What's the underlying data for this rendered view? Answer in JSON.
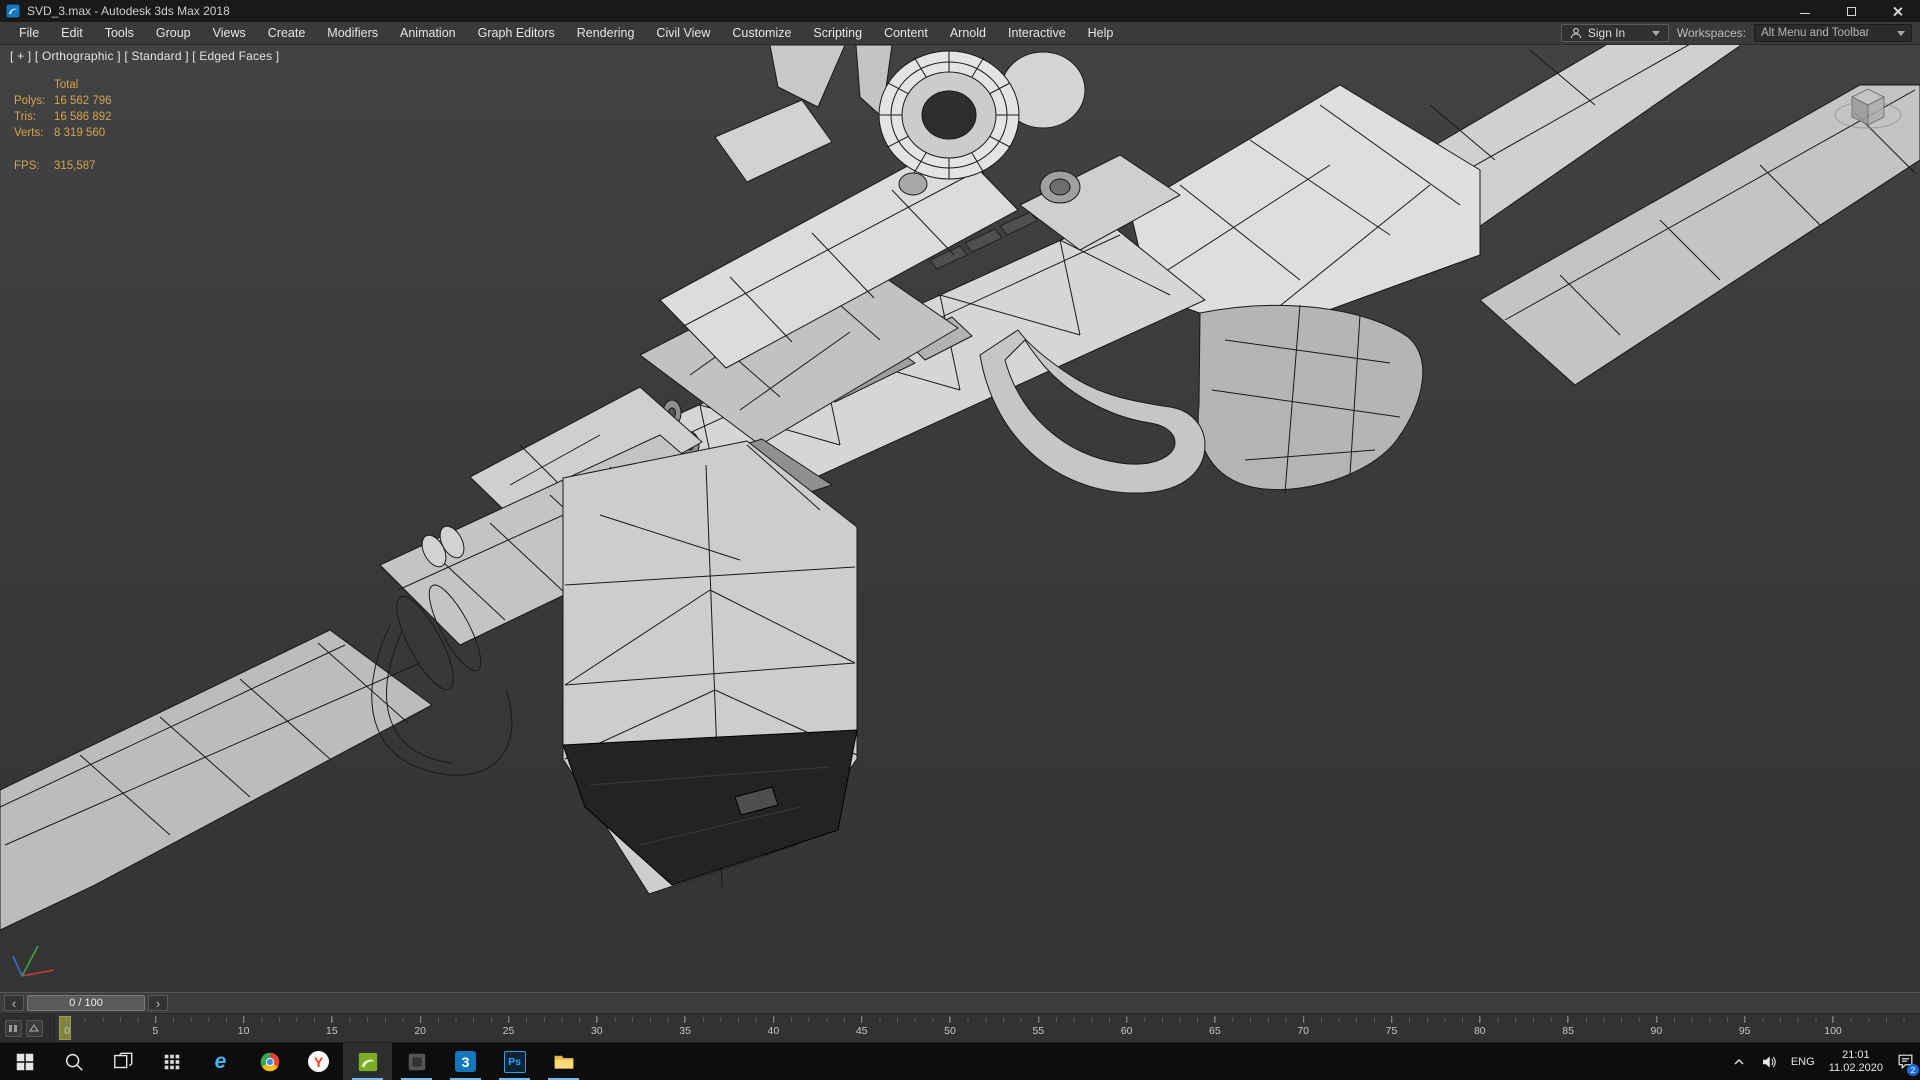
{
  "window": {
    "title": "SVD_3.max - Autodesk 3ds Max 2018"
  },
  "menubar": {
    "items": [
      "File",
      "Edit",
      "Tools",
      "Group",
      "Views",
      "Create",
      "Modifiers",
      "Animation",
      "Graph Editors",
      "Rendering",
      "Civil View",
      "Customize",
      "Scripting",
      "Content",
      "Arnold",
      "Interactive",
      "Help"
    ],
    "sign_in": "Sign In",
    "workspaces_label": "Workspaces:",
    "workspaces_value": "Alt Menu and Toolbar"
  },
  "viewport": {
    "label": "[ + ] [ Orthographic ] [ Standard ] [ Edged Faces ]",
    "stats": {
      "header": "Total",
      "rows": [
        {
          "label": "Polys:",
          "value": "16 562 796"
        },
        {
          "label": "Tris:",
          "value": "16 586 892"
        },
        {
          "label": "Verts:",
          "value": "8 319 560"
        }
      ],
      "fps_label": "FPS:",
      "fps_value": "315,587"
    }
  },
  "timeline": {
    "frame_display": "0 / 100",
    "prev": "‹",
    "next": "›",
    "ticks": [
      0,
      5,
      10,
      15,
      20,
      25,
      30,
      35,
      40,
      45,
      50,
      55,
      60,
      65,
      70,
      75,
      80,
      85,
      90,
      95,
      100
    ]
  },
  "taskbar": {
    "apps": [
      {
        "id": "start"
      },
      {
        "id": "search"
      },
      {
        "id": "task-view"
      },
      {
        "id": "app-grid"
      },
      {
        "id": "edge",
        "glyph": "e",
        "color": "#49b6f2"
      },
      {
        "id": "chrome"
      },
      {
        "id": "yandex",
        "glyph": "Y",
        "color": "#fc3f1d"
      },
      {
        "id": "3dsmax-green",
        "running": true,
        "active": true
      },
      {
        "id": "app-dark",
        "running": true
      },
      {
        "id": "3dsmax-blue",
        "glyph": "3",
        "color": "#ffffff",
        "running": true
      },
      {
        "id": "photoshop",
        "glyph": "Ps",
        "color": "#31a8ff",
        "running": true
      },
      {
        "id": "explorer",
        "running": true
      }
    ],
    "tray": {
      "language": "ENG",
      "time": "21:01",
      "date": "11.02.2020",
      "badge": "2"
    }
  }
}
